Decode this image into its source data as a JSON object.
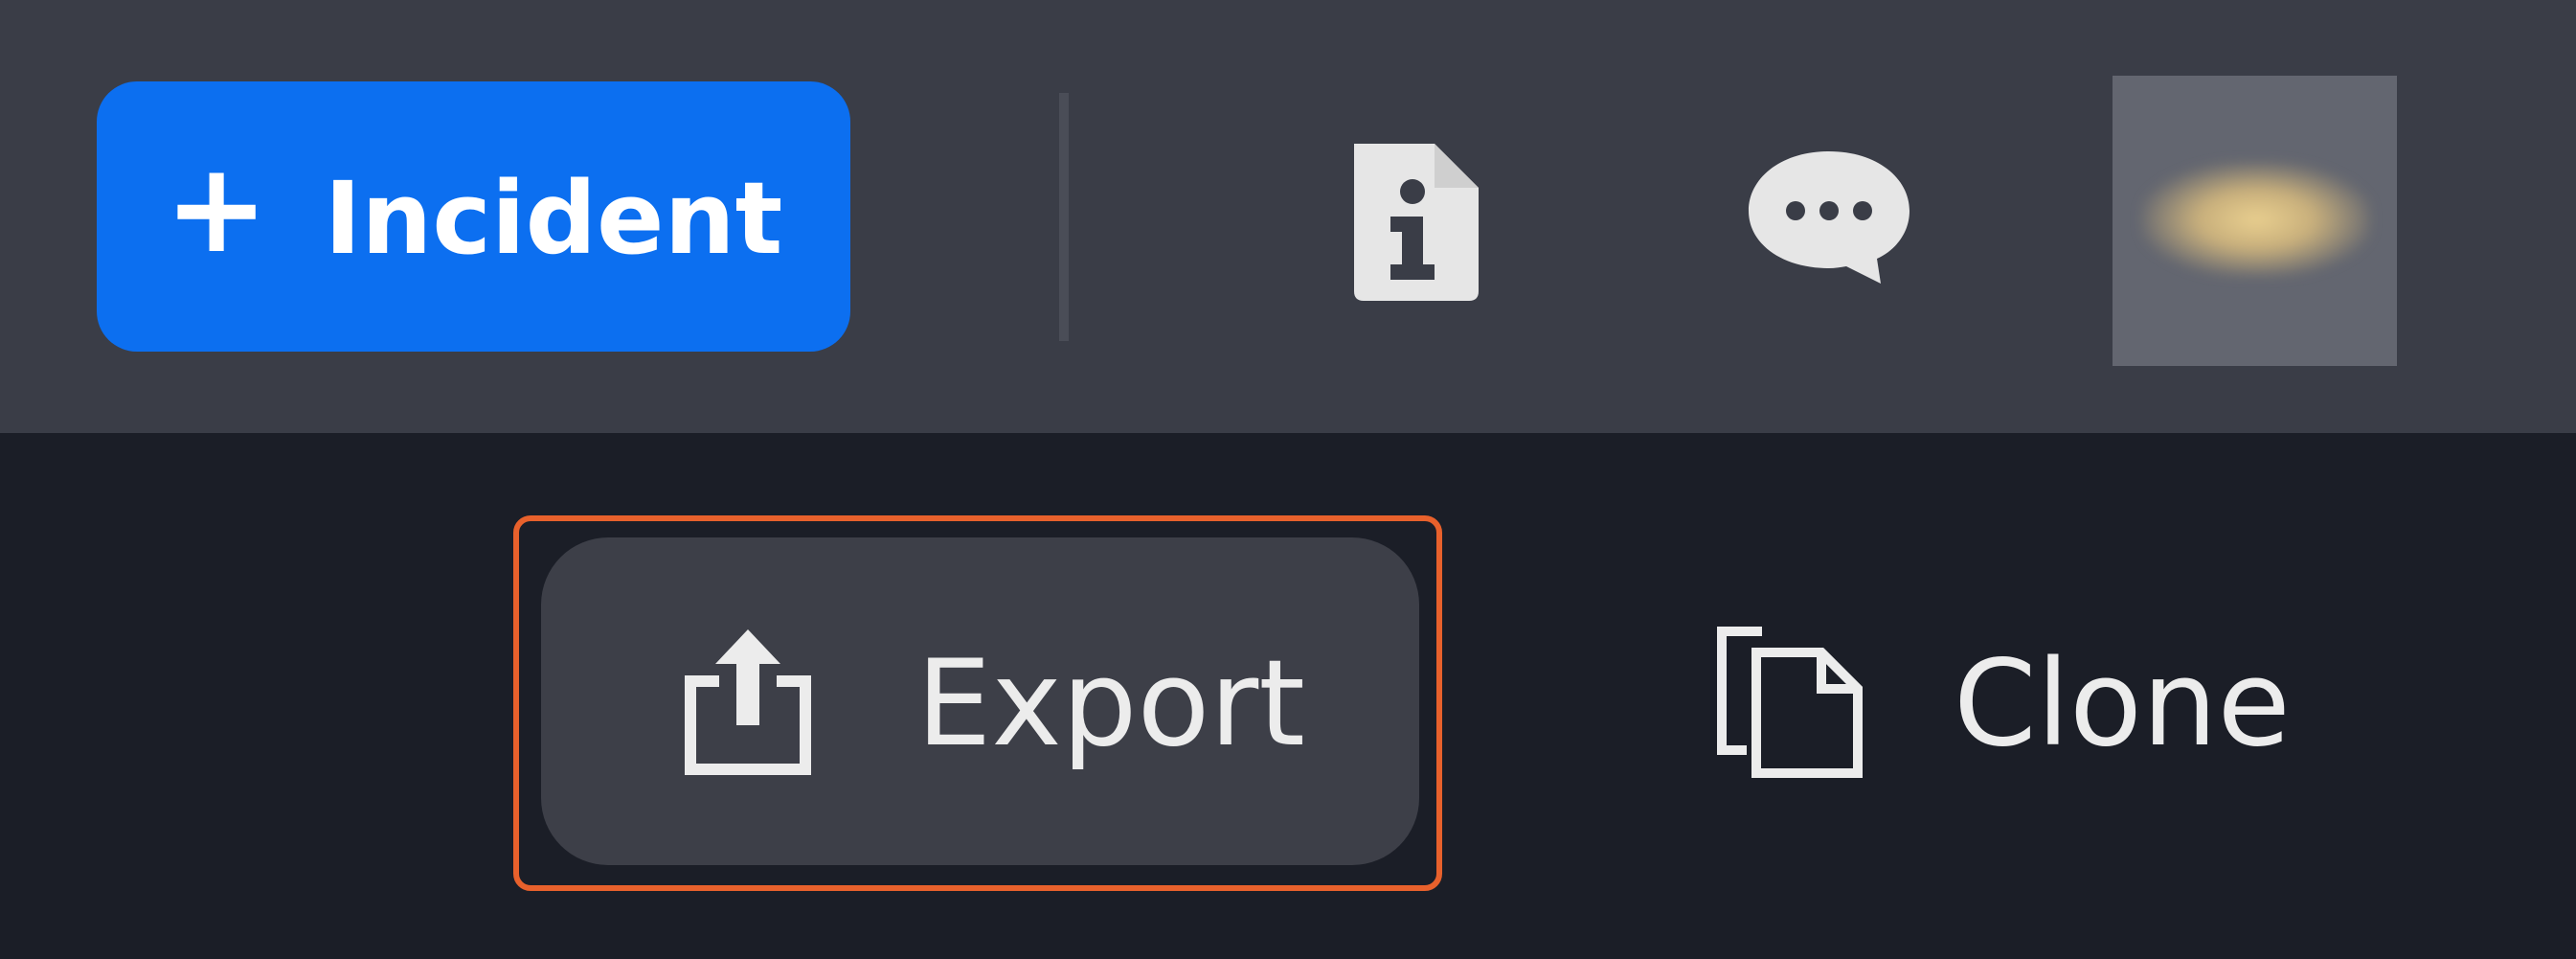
{
  "toolbar": {
    "new_incident": {
      "plus": "+",
      "label": "Incident"
    },
    "info_icon": "info-icon",
    "chat_icon": "chat-icon",
    "avatar": "avatar"
  },
  "actions": {
    "export_label": "Export",
    "clone_label": "Clone"
  },
  "colors": {
    "topbar_bg": "#3a3d47",
    "body_bg": "#1b1e27",
    "primary": "#0c6ff0",
    "focus_ring": "#e8612c",
    "export_bg": "#3d3f48"
  }
}
